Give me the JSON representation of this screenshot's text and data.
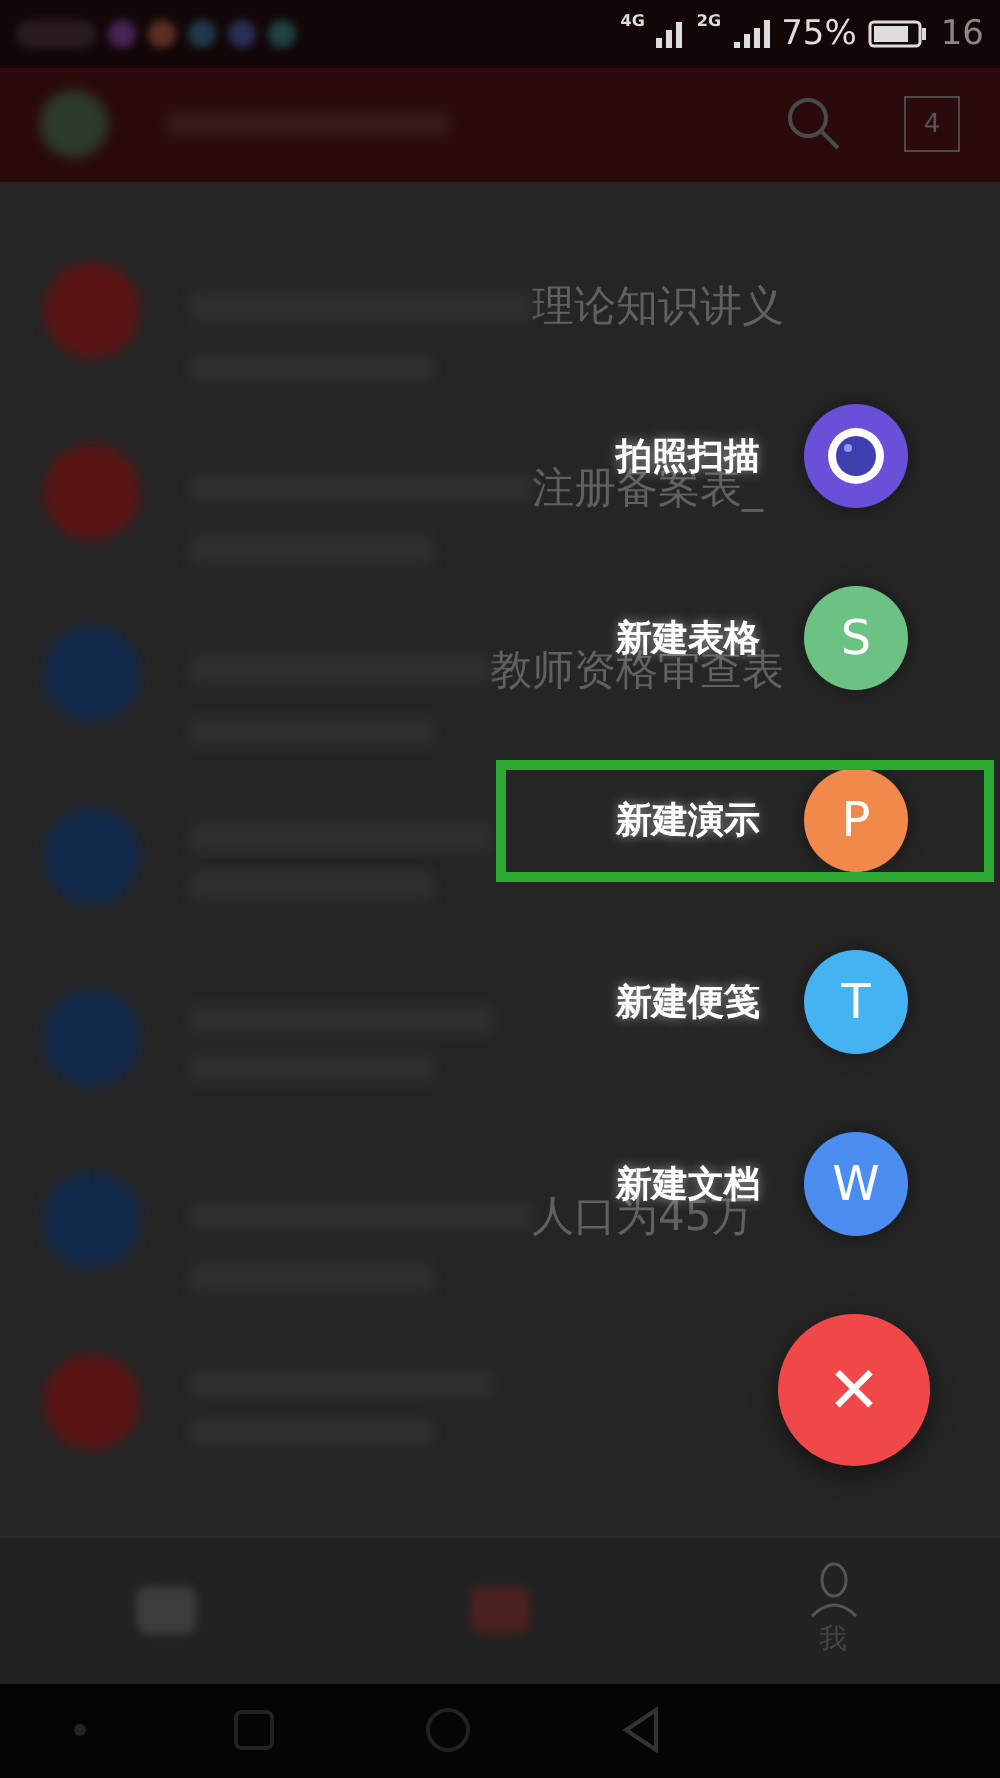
{
  "status_bar": {
    "network_1": "4G",
    "network_2": "2G",
    "battery": "75%",
    "time": "16"
  },
  "app_bar": {
    "tab_count": "4"
  },
  "list": [
    {
      "title": "理论知识讲义",
      "color": "#5a1414"
    },
    {
      "title": "注册备案表_",
      "color": "#5a1414"
    },
    {
      "title": "教师资格审查表",
      "color": "#10284a"
    },
    {
      "color": "#10284a"
    },
    {
      "color": "#10284a"
    },
    {
      "title": "人口为45万",
      "color": "#10284a"
    },
    {
      "color": "#5a1414"
    }
  ],
  "bottom_tabs": [
    {
      "label": "我"
    }
  ],
  "menu": [
    {
      "label": "拍照扫描",
      "kind": "camera",
      "color": "#6a4fd8",
      "highlighted": false
    },
    {
      "label": "新建表格",
      "kind": "letter",
      "glyph": "S",
      "color": "#6cc283",
      "highlighted": false
    },
    {
      "label": "新建演示",
      "kind": "letter",
      "glyph": "P",
      "color": "#f0894a",
      "highlighted": true
    },
    {
      "label": "新建便笺",
      "kind": "letter",
      "glyph": "T",
      "color": "#45b3f2",
      "highlighted": false
    },
    {
      "label": "新建文档",
      "kind": "letter",
      "glyph": "W",
      "color": "#4c8ef0",
      "highlighted": false
    }
  ],
  "close_button": {
    "glyph": "✕"
  }
}
